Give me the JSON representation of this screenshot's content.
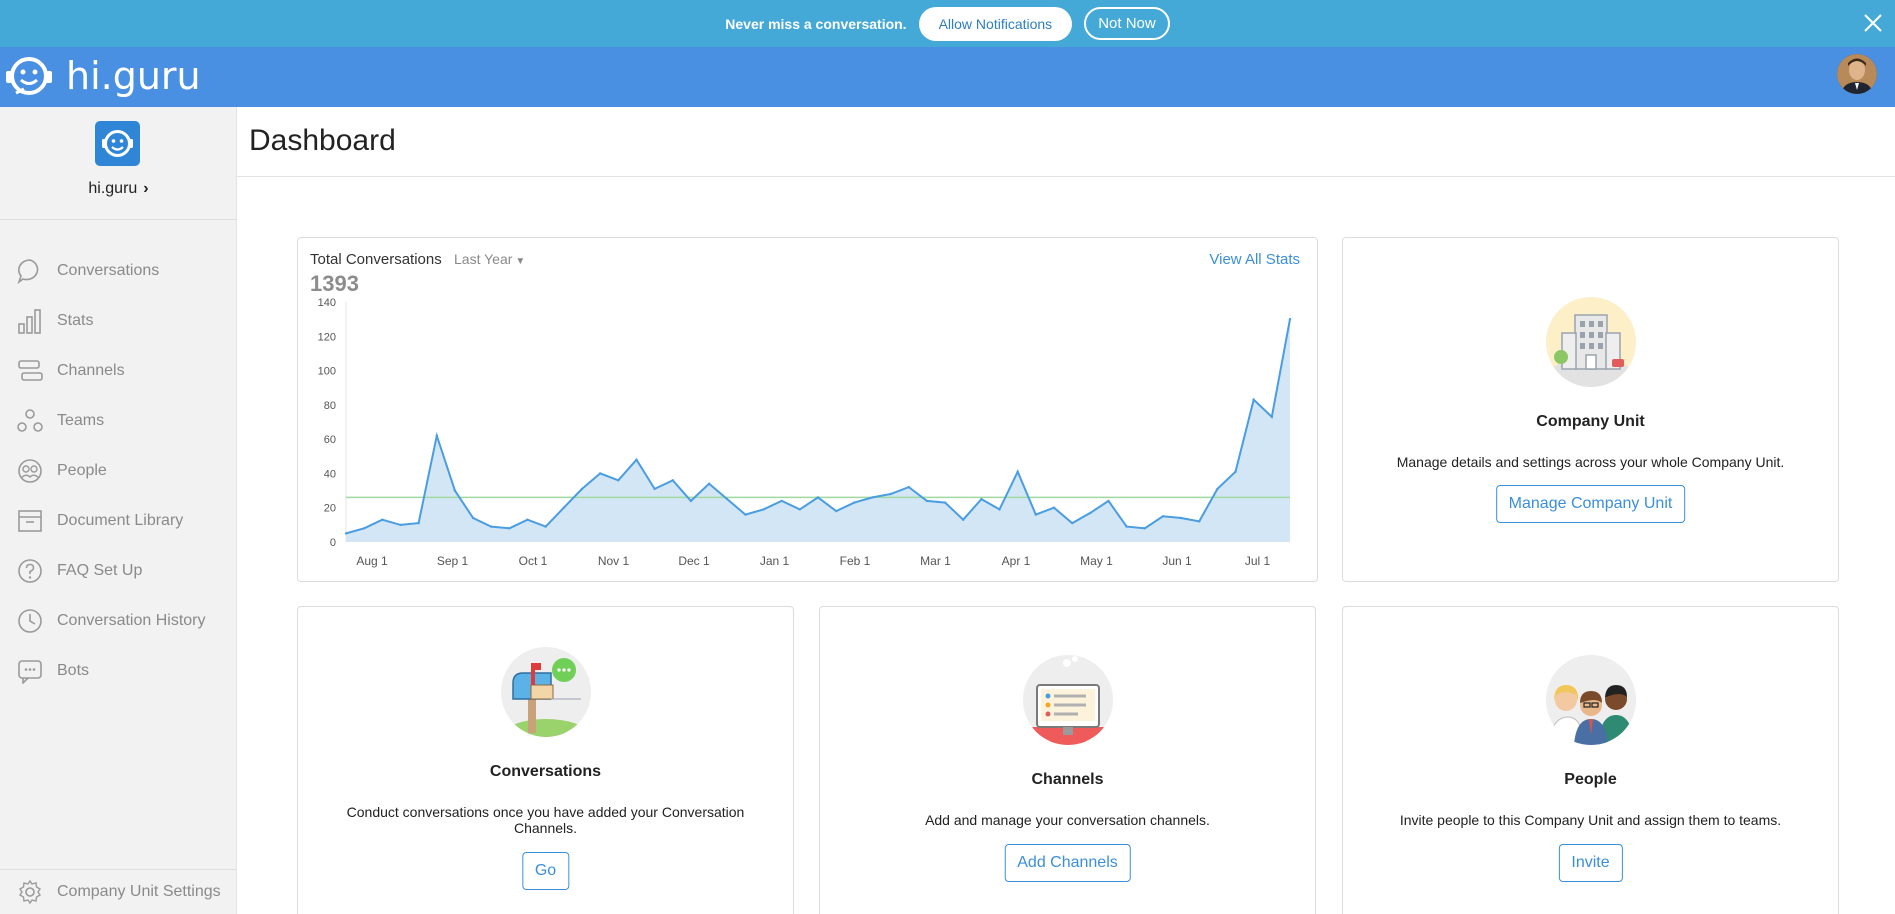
{
  "notification": {
    "message": "Never miss a conversation.",
    "allow_label": "Allow Notifications",
    "dismiss_label": "Not Now"
  },
  "header": {
    "logo_text": "hi.guru"
  },
  "sidebar": {
    "org_name": "hi.guru",
    "org_chevron": "›",
    "items": [
      {
        "label": "Conversations",
        "icon": "chat-bubble-icon"
      },
      {
        "label": "Stats",
        "icon": "bar-chart-icon"
      },
      {
        "label": "Channels",
        "icon": "channels-icon"
      },
      {
        "label": "Teams",
        "icon": "teams-icon"
      },
      {
        "label": "People",
        "icon": "people-icon"
      },
      {
        "label": "Document Library",
        "icon": "document-library-icon"
      },
      {
        "label": "FAQ Set Up",
        "icon": "question-icon"
      },
      {
        "label": "Conversation History",
        "icon": "history-icon"
      },
      {
        "label": "Bots",
        "icon": "bot-icon"
      }
    ],
    "settings_label": "Company Unit Settings"
  },
  "main": {
    "page_title": "Dashboard"
  },
  "stats_card": {
    "title": "Total Conversations",
    "range_label": "Last Year",
    "view_all_label": "View All Stats",
    "total": "1393"
  },
  "chart_data": {
    "type": "area",
    "title": "Total Conversations",
    "xlabel": "",
    "ylabel": "",
    "ylim": [
      0,
      140
    ],
    "yticks": [
      0,
      20,
      40,
      60,
      80,
      100,
      120,
      140
    ],
    "xticks": [
      "Aug 1",
      "Sep 1",
      "Oct 1",
      "Nov 1",
      "Dec 1",
      "Jan 1",
      "Feb 1",
      "Mar 1",
      "Apr 1",
      "May 1",
      "Jun 1",
      "Jul 1"
    ],
    "average": 26,
    "series": [
      {
        "values": [
          5,
          8,
          13,
          10,
          11,
          62,
          30,
          14,
          9,
          8,
          13,
          9,
          20,
          31,
          40,
          36,
          48,
          31,
          36,
          24,
          34,
          25,
          16,
          19,
          24,
          19,
          26,
          18,
          23,
          26,
          28,
          32,
          24,
          23,
          13,
          25,
          19,
          41,
          16,
          20,
          11,
          17,
          24,
          9,
          8,
          15,
          14,
          12,
          31,
          41,
          83,
          73,
          130
        ]
      }
    ],
    "colors": {
      "line": "#4a9de0",
      "fill": "#d2e6f6",
      "average": "#9fd99f"
    }
  },
  "cards": {
    "company_unit": {
      "title": "Company Unit",
      "description": "Manage details and settings across your whole Company Unit.",
      "button": "Manage Company Unit"
    },
    "conversations": {
      "title": "Conversations",
      "description": "Conduct conversations once you have added your Conversation Channels.",
      "button": "Go"
    },
    "channels": {
      "title": "Channels",
      "description": "Add and manage your conversation channels.",
      "button": "Add Channels"
    },
    "people": {
      "title": "People",
      "description": "Invite people to this Company Unit and assign them to teams.",
      "button": "Invite"
    }
  },
  "colors": {
    "notification_bar": "#45a9d8",
    "header": "#4a90e2",
    "accent": "#3b8fd9",
    "sidebar_bg": "#f2f2f2"
  }
}
